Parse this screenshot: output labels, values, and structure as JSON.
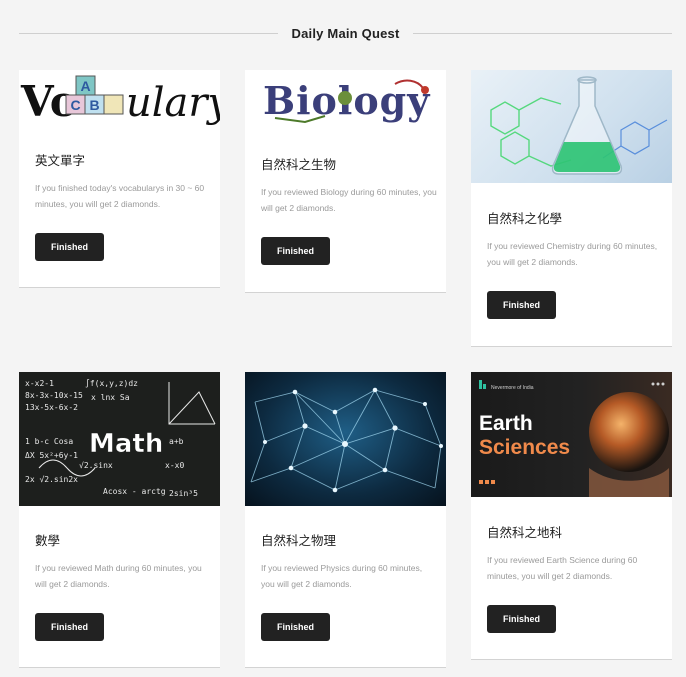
{
  "header": {
    "title": "Daily Main Quest"
  },
  "cards": [
    {
      "title": "英文單字",
      "description": "If you finished today's vocabularys in 30 ~ 60 minutes, you will get 2 diamonds.",
      "button": "Finished",
      "image": {
        "text": "Vocabulary",
        "blocks": [
          "A",
          "C",
          "B"
        ]
      }
    },
    {
      "title": "自然科之生物",
      "description": "If you reviewed Biology during 60 minutes, you will get 2 diamonds.",
      "button": "Finished",
      "image": {
        "text": "Biology"
      }
    },
    {
      "title": "自然科之化學",
      "description": "If you reviewed Chemistry during 60 minutes, you will get 2 diamonds.",
      "button": "Finished",
      "image": {
        "text": ""
      }
    },
    {
      "title": "數學",
      "description": "If you reviewed Math during 60 minutes, you will get 2 diamonds.",
      "button": "Finished",
      "image": {
        "text": "Math"
      }
    },
    {
      "title": "自然科之物理",
      "description": "If you reviewed Physics during 60 minutes, you will get 2 diamonds.",
      "button": "Finished",
      "image": {
        "text": ""
      }
    },
    {
      "title": "自然科之地科",
      "description": "If you reviewed Earth Science during 60 minutes, you will get 2 diamonds.",
      "button": "Finished",
      "image": {
        "line1": "Earth",
        "line2": "Sciences",
        "badge": "Nevermore of India"
      }
    }
  ],
  "colors": {
    "button_bg": "#222222",
    "earth_accent": "#f08a4b",
    "chem_green": "#3fd66a"
  }
}
